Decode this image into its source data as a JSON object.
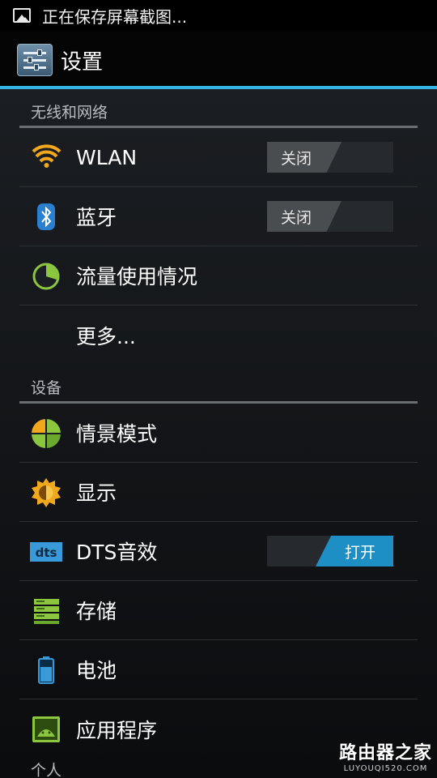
{
  "status_bar": {
    "notification_icon": "image-icon",
    "text": "正在保存屏幕截图..."
  },
  "action_bar": {
    "app_icon": "settings-sliders-icon",
    "title": "设置",
    "accent_color": "#33b5e5"
  },
  "sections": [
    {
      "header": "无线和网络",
      "items": [
        {
          "label": "WLAN",
          "icon": "wifi-icon",
          "toggle": "关闭"
        },
        {
          "label": "蓝牙",
          "icon": "bluetooth-icon",
          "toggle": "关闭"
        },
        {
          "label": "流量使用情况",
          "icon": "data-usage-icon"
        },
        {
          "label": "更多..."
        }
      ]
    },
    {
      "header": "设备",
      "items": [
        {
          "label": "情景模式",
          "icon": "profiles-icon"
        },
        {
          "label": "显示",
          "icon": "brightness-icon"
        },
        {
          "label": "DTS音效",
          "icon": "dts-icon",
          "toggle": "打开"
        },
        {
          "label": "存储",
          "icon": "storage-icon"
        },
        {
          "label": "电池",
          "icon": "battery-icon"
        },
        {
          "label": "应用程序",
          "icon": "apps-icon"
        }
      ]
    },
    {
      "header": "个人"
    }
  ],
  "watermark": {
    "main": "路由器之家",
    "sub": "LUYOUQI520.COM"
  },
  "colors": {
    "toggle_on": "#1e8fc4",
    "toggle_off": "#4a4d50",
    "background": "#1b1e22"
  }
}
